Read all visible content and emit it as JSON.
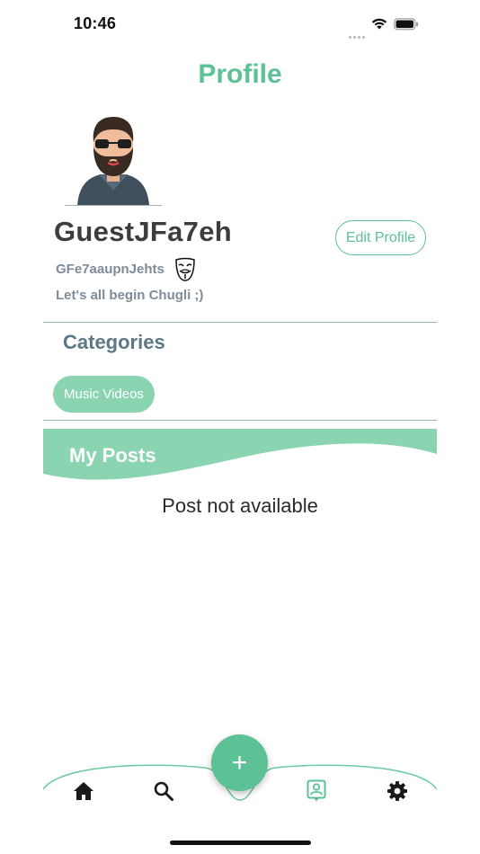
{
  "status_bar": {
    "time": "10:46"
  },
  "header": {
    "title": "Profile"
  },
  "profile": {
    "username": "GuestJFa7eh",
    "handle": "GFe7aaupnJehts",
    "bio": "Let's all begin Chugli ;)",
    "edit_button_label": "Edit Profile",
    "avatar_icon": "bearded-man-avatar",
    "handle_badge_icon": "anonymous-mask-icon"
  },
  "categories": {
    "heading": "Categories",
    "items": [
      "Music Videos"
    ]
  },
  "posts": {
    "heading": "My Posts",
    "empty_message": "Post not available"
  },
  "bottom_nav": {
    "items": [
      "home-icon",
      "search-icon",
      "profile-icon",
      "settings-icon"
    ],
    "active": "profile-icon",
    "fab_symbol": "+"
  },
  "colors": {
    "accent": "#5cc195",
    "chip": "#8bd4b1",
    "heading_slate": "#5d7787",
    "muted_text": "#7e8b99"
  }
}
